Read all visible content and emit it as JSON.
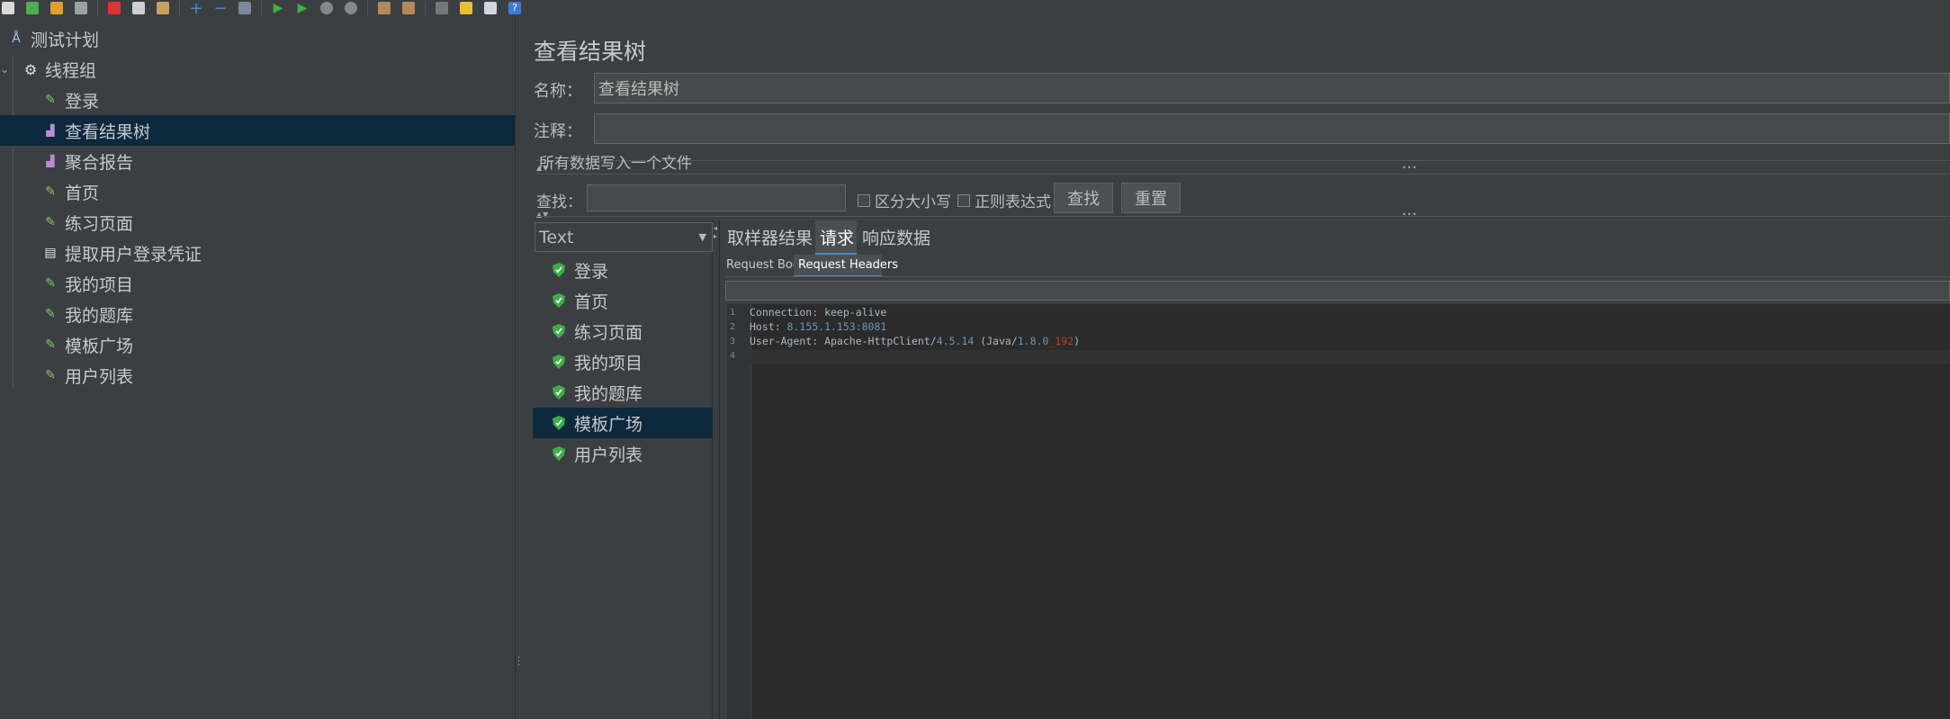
{
  "toolbar": {
    "icons": [
      "new-icon",
      "templates-icon",
      "open-icon",
      "save-icon",
      "cut-icon",
      "copy-icon",
      "paste-icon",
      "expand-icon",
      "collapse-icon",
      "toggle-icon",
      "start-icon",
      "start-no-pause-icon",
      "stop-icon",
      "shutdown-icon",
      "clear-icon",
      "clear-all-icon",
      "search-icon",
      "reset-search-icon",
      "function-helper-icon",
      "help-icon"
    ]
  },
  "tree": {
    "items": [
      {
        "label": "测试计划",
        "icon": "test-plan-icon"
      },
      {
        "label": "线程组",
        "icon": "gear-icon"
      },
      {
        "label": "登录",
        "icon": "sampler-icon"
      },
      {
        "label": "查看结果树",
        "icon": "listener-icon"
      },
      {
        "label": "聚合报告",
        "icon": "listener-icon"
      },
      {
        "label": "首页",
        "icon": "sampler-icon"
      },
      {
        "label": "练习页面",
        "icon": "sampler-icon"
      },
      {
        "label": "提取用户登录凭证",
        "icon": "postprocessor-icon"
      },
      {
        "label": "我的项目",
        "icon": "sampler-icon"
      },
      {
        "label": "我的题库",
        "icon": "sampler-icon"
      },
      {
        "label": "模板广场",
        "icon": "sampler-icon"
      },
      {
        "label": "用户列表",
        "icon": "sampler-icon"
      }
    ]
  },
  "panel": {
    "title": "查看结果树",
    "name_label": "名称：",
    "name_value": "查看结果树",
    "comment_label": "注释：",
    "comment_value": "",
    "write_all_label": "所有数据写入一个文件",
    "search_label": "查找：",
    "search_value": "",
    "case_sensitive_label": "区分大小写",
    "regex_label": "正则表达式",
    "find_button": "查找",
    "reset_button": "重置"
  },
  "renderer": {
    "selected": "Text"
  },
  "results": [
    {
      "label": "登录"
    },
    {
      "label": "首页"
    },
    {
      "label": "练习页面"
    },
    {
      "label": "我的项目"
    },
    {
      "label": "我的题库"
    },
    {
      "label": "模板广场"
    },
    {
      "label": "用户列表"
    }
  ],
  "tabs": [
    "取样器结果",
    "请求",
    "响应数据"
  ],
  "subtabs": [
    "Request Body",
    "Request Headers"
  ],
  "headers": {
    "line1": "Connection: keep-alive",
    "line2_key": "Host: ",
    "line2_val": "8.155.1.153:8081",
    "line3_key": "User-Agent: Apache-HttpClient/",
    "line3_ver": "4.5.14",
    "line3_mid": " (Java/",
    "line3_jv1": "1.8.0",
    "line3_jv2": "_192",
    "line3_end": ")"
  },
  "line_numbers": [
    "1",
    "2",
    "3",
    "4"
  ],
  "colors": {
    "selection": "#0d293e",
    "accent": "#4a88c7",
    "shield": "#3fae49"
  }
}
